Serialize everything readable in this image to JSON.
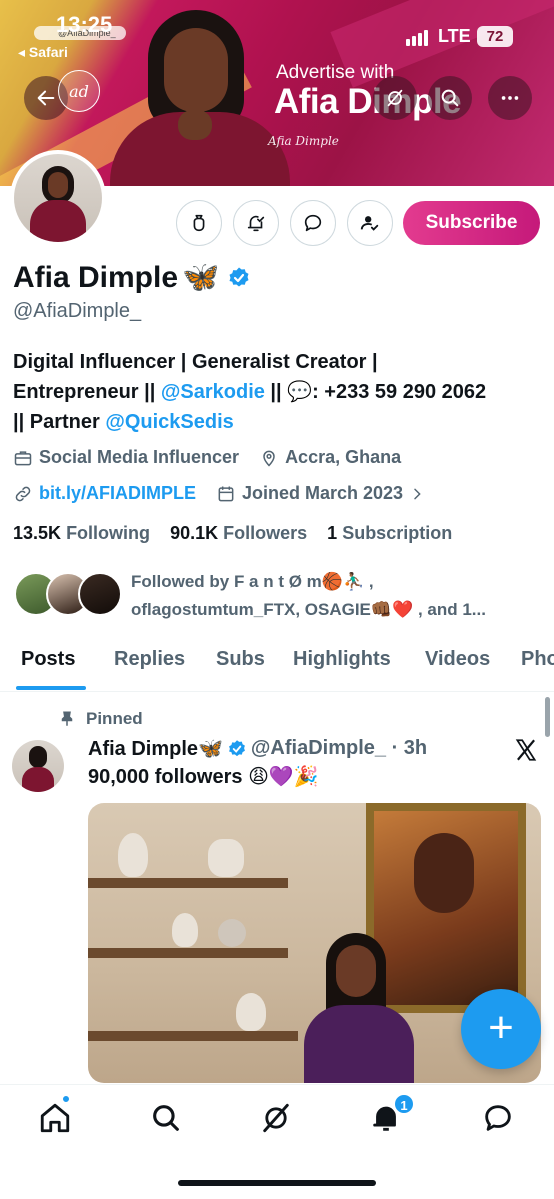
{
  "status_bar": {
    "time": "13:25",
    "back_app": "◂ Safari",
    "url_hint": "@AfiaDimple_",
    "network": "LTE",
    "battery": "72"
  },
  "banner": {
    "advertise_text": "Advertise with",
    "brand_text": "Afia Dimple",
    "signature": "Afia Dimple",
    "logo_text": "ad"
  },
  "profile": {
    "name": "Afia Dimple",
    "name_emoji": "🦋",
    "handle": "@AfiaDimple_",
    "subscribe_label": "Subscribe",
    "bio_line1": "Digital Influencer | Generalist Creator |",
    "bio_line2_a": "Entrepreneur || ",
    "bio_mention1": "@Sarkodie",
    "bio_line2_b": " || 💬: +233 59 290 2062",
    "bio_line3_a": "|| Partner ",
    "bio_mention2": "@QuickSedis",
    "category": "Social Media Influencer",
    "location": "Accra, Ghana",
    "website": "bit.ly/AFIADIMPLE",
    "joined": "Joined March 2023",
    "following_count": "13.5K",
    "following_label": "Following",
    "followers_count": "90.1K",
    "followers_label": "Followers",
    "subscription_count": "1",
    "subscription_label": "Subscription",
    "followed_by_line1": "Followed by F a n t Ø m🏀⛹🏾‍♂️ ,",
    "followed_by_line2": "oflagostumtum_FTX, OSAGIE👊🏾❤️ , and 1..."
  },
  "tabs": [
    "Posts",
    "Replies",
    "Subs",
    "Highlights",
    "Videos",
    "Pho"
  ],
  "post": {
    "pinned_label": "Pinned",
    "author": "Afia Dimple🦋",
    "handle_time": "@AfiaDimple_ · 3h",
    "text": "90,000 followers 😩💜🎉"
  },
  "bottom_nav": {
    "notification_count": "1"
  },
  "colors": {
    "accent": "#1d9bf0",
    "subscribe_gradient_start": "#e33b8f",
    "subscribe_gradient_end": "#c5197a",
    "text_primary": "#0f1419",
    "text_secondary": "#536471"
  }
}
